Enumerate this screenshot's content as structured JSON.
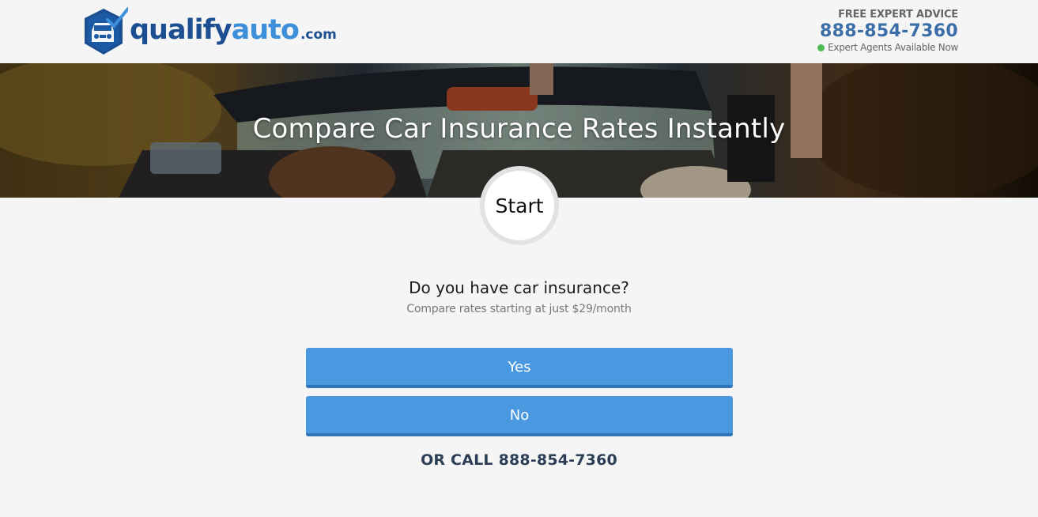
{
  "header": {
    "logo": {
      "part1": "qualify",
      "part2": "auto",
      "part3": ".com"
    },
    "contact": {
      "label": "FREE EXPERT ADVICE",
      "phone": "888-854-7360",
      "status": "Expert Agents Available Now",
      "status_color": "#4cba55"
    }
  },
  "hero": {
    "title": "Compare Car Insurance Rates Instantly"
  },
  "step": {
    "label": "Start"
  },
  "form": {
    "question": "Do you have car insurance?",
    "subtext": "Compare rates starting at just $29/month",
    "options": [
      "Yes",
      "No"
    ],
    "button_color": "#4a98e0"
  },
  "footer_call": {
    "prefix": "OR CALL",
    "phone": "888-854-7360"
  },
  "colors": {
    "brand_dark": "#1c4f92",
    "brand_light": "#3d8fd9",
    "phone": "#3b6ea8"
  }
}
